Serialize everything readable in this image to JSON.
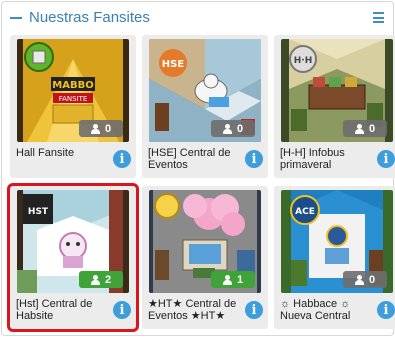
{
  "header": {
    "title": "Nuestras Fansites"
  },
  "rooms": [
    {
      "name": "Hall Fansite",
      "users": "0",
      "selected": false
    },
    {
      "name": "[HSE] Central de Eventos",
      "users": "0",
      "selected": false
    },
    {
      "name": "[H-H] Infobus primaveral",
      "users": "0",
      "selected": false
    },
    {
      "name": "[Hst] Central de Habsite",
      "users": "2",
      "selected": true
    },
    {
      "name": "★HT★ Central de Eventos ★HT★",
      "users": "1",
      "selected": false
    },
    {
      "name": "☼ Habbace ☼ Nueva Central",
      "users": "0",
      "selected": false
    }
  ],
  "thumb_texts": {
    "mabbo": "MABBO",
    "fansite": "FANSITE",
    "hse": "HSE",
    "hh": "H·H",
    "hst": "HST",
    "ace": "ACE"
  },
  "colors": {
    "accent": "#3a8fc8",
    "selected_border": "#d9161d",
    "badge_active": "#3fa33a",
    "badge_idle": "#6e6e6e",
    "info": "#3e9ddb"
  }
}
